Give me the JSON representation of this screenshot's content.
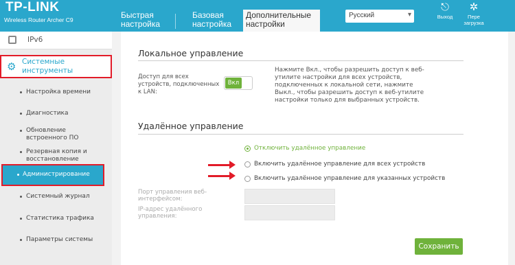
{
  "header": {
    "logo": "TP-LINK",
    "model": "Wireless Router Archer C9",
    "tabs": [
      {
        "label": "Быстрая настройка"
      },
      {
        "label": "Базовая настройка"
      },
      {
        "label": "Дополнительные настройки",
        "active": true
      }
    ],
    "language": "Русский",
    "logout_label": "Выход",
    "reboot_label": "Пере загрузка"
  },
  "sidebar": {
    "ipv6": "IPv6",
    "system_tools": "Системные инструменты",
    "items": [
      "Настройка времени",
      "Диагностика",
      "Обновление встроенного ПО",
      "Резервная копия и восстановление",
      "Администрирование",
      "Системный журнал",
      "Статистика трафика",
      "Параметры системы"
    ],
    "active_index": 4
  },
  "local": {
    "title": "Локальное управление",
    "access_label": "Доступ для всех устройств, подключенных к LAN:",
    "toggle_label": "Вкл",
    "description": "Нажмите Вкл., чтобы разрешить доступ к веб-утилите настройки для всех устройств, подключенных к локальной сети, нажмите Выкл., чтобы разрешить доступ к веб-утилите настройки только для выбранных устройств."
  },
  "remote": {
    "title": "Удалённое управление",
    "options": [
      {
        "label": "Отключить удалённое управление",
        "selected": true
      },
      {
        "label": "Включить удалённое управление для всех устройств",
        "selected": false
      },
      {
        "label": "Включить удалённое управление для указанных устройств",
        "selected": false
      }
    ],
    "port_label": "Порт управления веб-интерфейсом:",
    "ip_label": "IP-адрес удалённого управления:"
  },
  "save_label": "Сохранить",
  "colors": {
    "accent": "#2aa7cc",
    "green": "#6fb23b",
    "highlight": "#e21b28"
  }
}
